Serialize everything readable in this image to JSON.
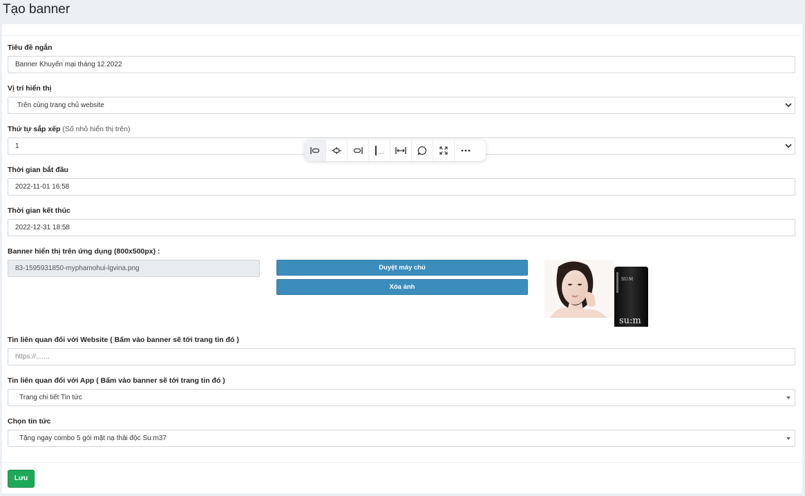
{
  "page": {
    "title": "Tạo banner"
  },
  "form": {
    "short_title": {
      "label": "Tiêu đề ngắn",
      "value": "Banner Khuyến mại tháng 12.2022"
    },
    "position": {
      "label": "Vị trí hiển thị",
      "value": "Trên cùng trang chủ website"
    },
    "order": {
      "label": "Thứ tự sắp xếp",
      "hint": "(Số nhỏ hiển thị trên)",
      "value": "1"
    },
    "start_time": {
      "label": "Thời gian bắt đầu",
      "value": "2022-11-01 16:58"
    },
    "end_time": {
      "label": "Thời gian kết thúc",
      "value": "2022-12-31 18:58"
    },
    "banner": {
      "label": "Banner hiển thị trên ứng dụng (800x500px) :",
      "filename": "83-1595931850-myphamohui-lgvina.png",
      "browse_label": "Duyệt máy chủ",
      "delete_label": "Xóa ảnh",
      "thumb_product_text": "su:m"
    },
    "website_link": {
      "label": "Tin liên quan đối với Website ( Bấm vào banner sẽ tới trang tin đó )",
      "placeholder": "https://......."
    },
    "app_link": {
      "label": "Tin liên quan đối với App ( Bấm vào banner sẽ tới trang tin đó )",
      "value": "Trang chi tiết Tin tức"
    },
    "news": {
      "label": "Chọn tin tức",
      "value": "Tặng ngay combo 5 gói mặt nạ thải độc Su:m37"
    },
    "save_label": "Lưu"
  },
  "toolbar": {
    "icons": [
      "align-left-icon",
      "align-center-icon",
      "align-right-icon",
      "inline-icon",
      "full-width-icon",
      "comment-icon",
      "expand-icon",
      "more-icon"
    ]
  }
}
